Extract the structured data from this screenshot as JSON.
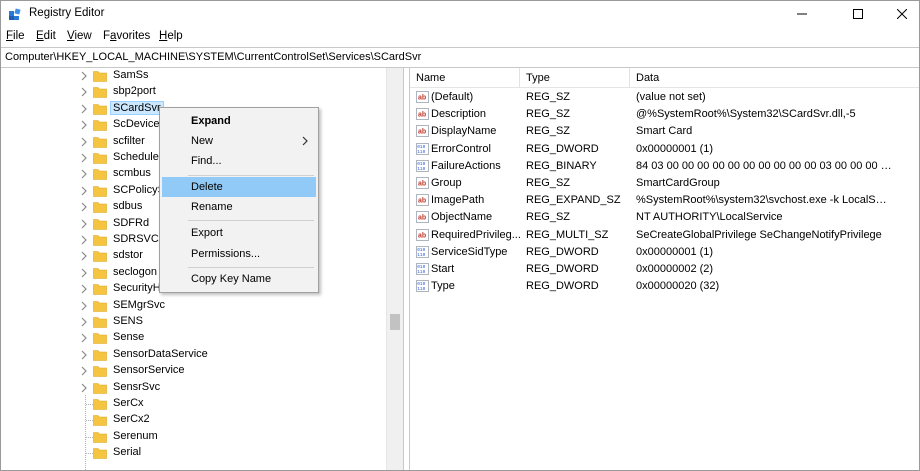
{
  "window": {
    "title": "Registry Editor",
    "icon": "registry-icon",
    "controls": [
      "minimize-icon",
      "maximize-icon",
      "close-icon"
    ]
  },
  "menu": [
    {
      "label": "File",
      "accel": "F",
      "rest": "ile"
    },
    {
      "label": "Edit",
      "accel": "E",
      "rest": "dit"
    },
    {
      "label": "View",
      "accel": "V",
      "rest": "iew"
    },
    {
      "label": "Favorites",
      "accel": "a",
      "pre": "F",
      "rest": "vorites"
    },
    {
      "label": "Help",
      "accel": "H",
      "rest": "elp"
    }
  ],
  "address": "Computer\\HKEY_LOCAL_MACHINE\\SYSTEM\\CurrentControlSet\\Services\\SCardSvr",
  "tree": {
    "selected": "SCardSvr",
    "items": [
      {
        "label": "SamSs",
        "expandable": true
      },
      {
        "label": "sbp2port",
        "expandable": true
      },
      {
        "label": "SCardSvr",
        "expandable": true
      },
      {
        "label": "ScDeviceEnum",
        "expandable": true
      },
      {
        "label": "scfilter",
        "expandable": true
      },
      {
        "label": "Schedule",
        "expandable": true
      },
      {
        "label": "scmbus",
        "expandable": true
      },
      {
        "label": "SCPolicySvc",
        "expandable": true
      },
      {
        "label": "sdbus",
        "expandable": true
      },
      {
        "label": "SDFRd",
        "expandable": true
      },
      {
        "label": "SDRSVC",
        "expandable": true
      },
      {
        "label": "sdstor",
        "expandable": true
      },
      {
        "label": "seclogon",
        "expandable": true
      },
      {
        "label": "SecurityHealthService",
        "expandable": true
      },
      {
        "label": "SEMgrSvc",
        "expandable": true
      },
      {
        "label": "SENS",
        "expandable": true
      },
      {
        "label": "Sense",
        "expandable": true
      },
      {
        "label": "SensorDataService",
        "expandable": true
      },
      {
        "label": "SensorService",
        "expandable": true
      },
      {
        "label": "SensrSvc",
        "expandable": true
      },
      {
        "label": "SerCx",
        "expandable": false
      },
      {
        "label": "SerCx2",
        "expandable": false
      },
      {
        "label": "Serenum",
        "expandable": false
      },
      {
        "label": "Serial",
        "expandable": false
      }
    ]
  },
  "values": {
    "columns": [
      "Name",
      "Type",
      "Data"
    ],
    "rows": [
      {
        "icon": "string-value-icon",
        "name": "(Default)",
        "type": "REG_SZ",
        "data": "(value not set)"
      },
      {
        "icon": "string-value-icon",
        "name": "Description",
        "type": "REG_SZ",
        "data": "@%SystemRoot%\\System32\\SCardSvr.dll,-5"
      },
      {
        "icon": "string-value-icon",
        "name": "DisplayName",
        "type": "REG_SZ",
        "data": "Smart Card"
      },
      {
        "icon": "binary-value-icon",
        "name": "ErrorControl",
        "type": "REG_DWORD",
        "data": "0x00000001 (1)"
      },
      {
        "icon": "binary-value-icon",
        "name": "FailureActions",
        "type": "REG_BINARY",
        "data": "84 03 00 00 00 00 00 00 00 00 00 00 03 00 00 00 14 00..."
      },
      {
        "icon": "string-value-icon",
        "name": "Group",
        "type": "REG_SZ",
        "data": "SmartCardGroup"
      },
      {
        "icon": "string-value-icon",
        "name": "ImagePath",
        "type": "REG_EXPAND_SZ",
        "data": "%SystemRoot%\\system32\\svchost.exe -k LocalSer..."
      },
      {
        "icon": "string-value-icon",
        "name": "ObjectName",
        "type": "REG_SZ",
        "data": "NT AUTHORITY\\LocalService"
      },
      {
        "icon": "string-value-icon",
        "name": "RequiredPrivileg...",
        "type": "REG_MULTI_SZ",
        "data": "SeCreateGlobalPrivilege SeChangeNotifyPrivilege"
      },
      {
        "icon": "binary-value-icon",
        "name": "ServiceSidType",
        "type": "REG_DWORD",
        "data": "0x00000001 (1)"
      },
      {
        "icon": "binary-value-icon",
        "name": "Start",
        "type": "REG_DWORD",
        "data": "0x00000002 (2)"
      },
      {
        "icon": "binary-value-icon",
        "name": "Type",
        "type": "REG_DWORD",
        "data": "0x00000020 (32)"
      }
    ]
  },
  "context_menu": {
    "items": [
      {
        "label": "Expand",
        "bold": true
      },
      {
        "label": "New",
        "submenu": true
      },
      {
        "label": "Find...",
        "separator_after": true
      },
      {
        "label": "Delete",
        "highlighted": true
      },
      {
        "label": "Rename",
        "separator_after": true
      },
      {
        "label": "Export"
      },
      {
        "label": "Permissions...",
        "separator_after": true
      },
      {
        "label": "Copy Key Name"
      }
    ]
  },
  "colors": {
    "folder": "#f5c542",
    "selection": "#cce8ff",
    "menu_highlight": "#91c9f7",
    "string_icon": "#c0392b",
    "binary_icon": "#2a5bd7"
  }
}
